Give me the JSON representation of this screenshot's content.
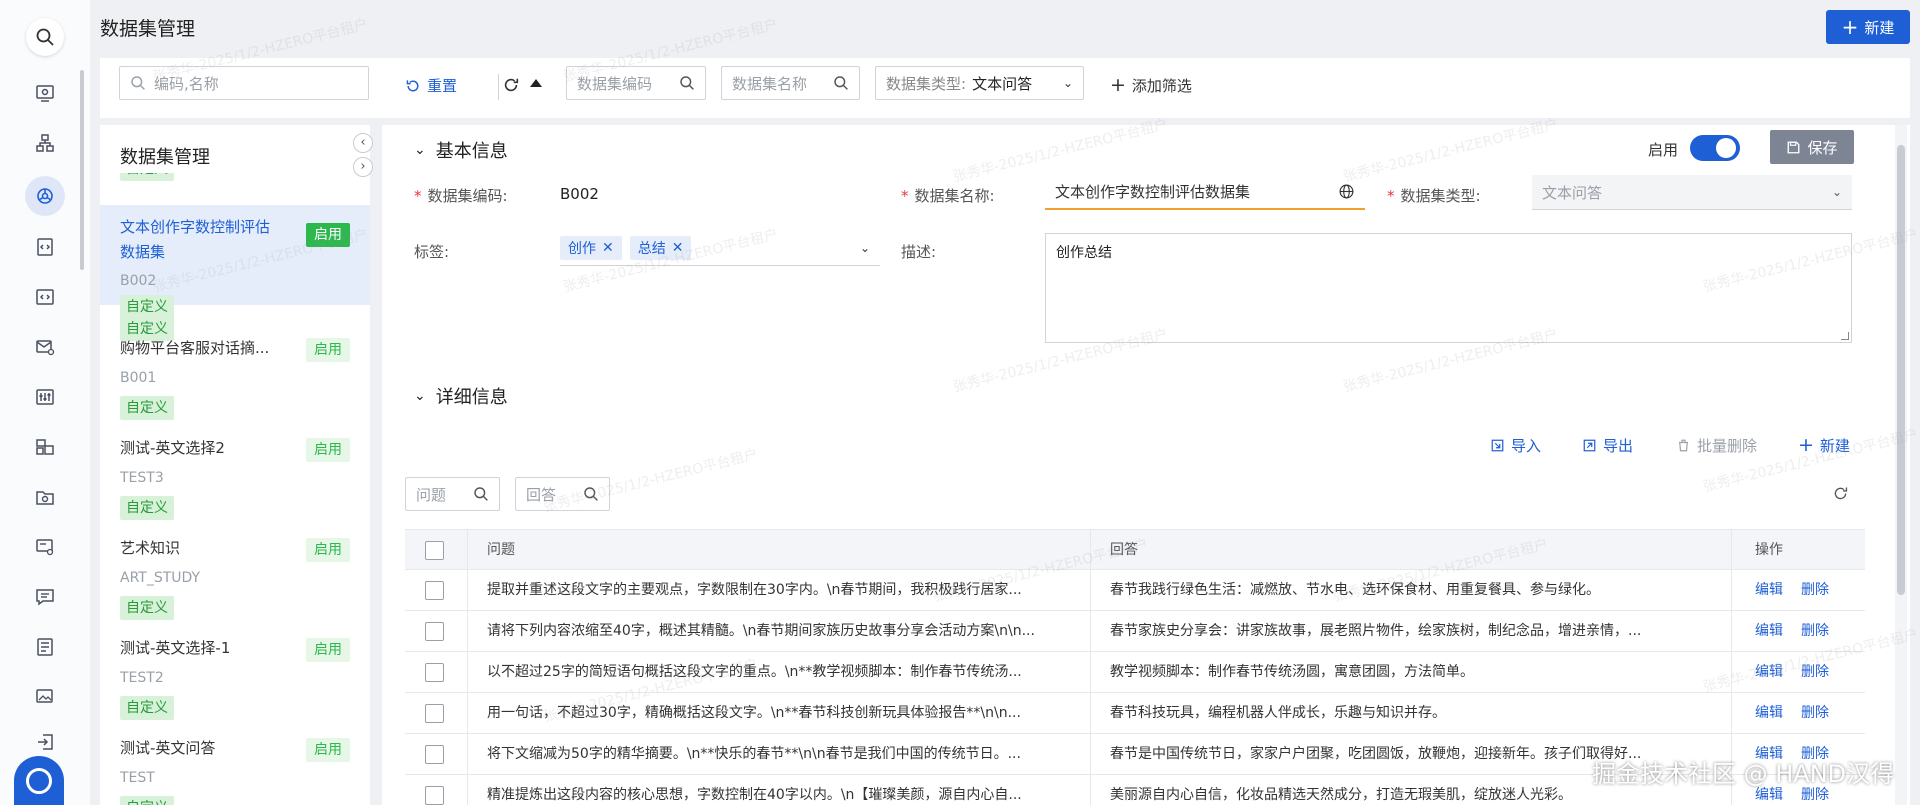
{
  "header": {
    "title": "数据集管理",
    "new_label": "新建"
  },
  "toolbar": {
    "search_placeholder": "编码,名称",
    "reset_label": "重置",
    "filter_code_placeholder": "数据集编码",
    "filter_name_placeholder": "数据集名称",
    "filter_type_label": "数据集类型:",
    "filter_type_value": "文本问答",
    "add_filter_label": "添加筛选"
  },
  "sidebar": {
    "title": "数据集管理",
    "partial_tag": "自定义",
    "items": [
      {
        "name": "文本创作字数控制评估数据集",
        "code": "B002",
        "tag": "自定义",
        "status": "启用"
      },
      {
        "name": "购物平台客服对话摘...",
        "code": "B001",
        "tag": "自定义",
        "status": "启用"
      },
      {
        "name": "测试-英文选择2",
        "code": "TEST3",
        "tag": "自定义",
        "status": "启用"
      },
      {
        "name": "艺术知识",
        "code": "ART_STUDY",
        "tag": "自定义",
        "status": "启用"
      },
      {
        "name": "测试-英文选择-1",
        "code": "TEST2",
        "tag": "自定义",
        "status": "启用"
      },
      {
        "name": "测试-英文问答",
        "code": "TEST",
        "tag": "自定义",
        "status": "启用"
      }
    ]
  },
  "basic": {
    "section_title": "基本信息",
    "enable_label": "启用",
    "save_label": "保存",
    "code_label": "数据集编码:",
    "code_value": "B002",
    "name_label": "数据集名称:",
    "name_value": "文本创作字数控制评估数据集",
    "type_label": "数据集类型:",
    "type_value": "文本问答",
    "tags_label": "标签:",
    "tags": [
      "创作",
      "总结"
    ],
    "desc_label": "描述:",
    "desc_value": "创作总结"
  },
  "detail": {
    "section_title": "详细信息",
    "import_label": "导入",
    "export_label": "导出",
    "batch_delete_label": "批量删除",
    "new_label": "新建",
    "question_placeholder": "问题",
    "answer_placeholder": "回答",
    "columns": {
      "question": "问题",
      "answer": "回答",
      "actions": "操作"
    },
    "edit_label": "编辑",
    "delete_label": "删除",
    "rows": [
      {
        "q": "提取并重述这段文字的主要观点，字数限制在30字内。\\n春节期间，我积极践行居家...",
        "a": "春节我践行绿色生活：减燃放、节水电、选环保食材、用重复餐具、参与绿化。"
      },
      {
        "q": "请将下列内容浓缩至40字，概述其精髓。\\n春节期间家族历史故事分享会活动方案\\n\\n...",
        "a": "春节家族史分享会：讲家族故事，展老照片物件，绘家族树，制纪念品，增进亲情，..."
      },
      {
        "q": "以不超过25字的简短语句概括这段文字的重点。\\n**教学视频脚本：制作春节传统汤...",
        "a": "教学视频脚本：制作春节传统汤圆，寓意团圆，方法简单。"
      },
      {
        "q": "用一句话，不超过30字，精确概括这段文字。\\n**春节科技创新玩具体验报告**\\n\\n...",
        "a": "春节科技玩具，编程机器人伴成长，乐趣与知识并存。"
      },
      {
        "q": "将下文缩减为50字的精华摘要。\\n**快乐的春节**\\n\\n春节是我们中国的传统节日。...",
        "a": "春节是中国传统节日，家家户户团聚，吃团圆饭，放鞭炮，迎接新年。孩子们取得好..."
      },
      {
        "q": "精准提炼出这段内容的核心思想，字数控制在40字以内。\\n【璀璨美颜，源自内心自...",
        "a": "美丽源自内心自信，化妆品精选天然成分，打造无瑕美肌，绽放迷人光彩。"
      }
    ]
  },
  "footer_watermark": "掘金技术社区 @ HAND汉得",
  "watermark_text": "张秀华-2025/1/2-HZERO平台租户"
}
